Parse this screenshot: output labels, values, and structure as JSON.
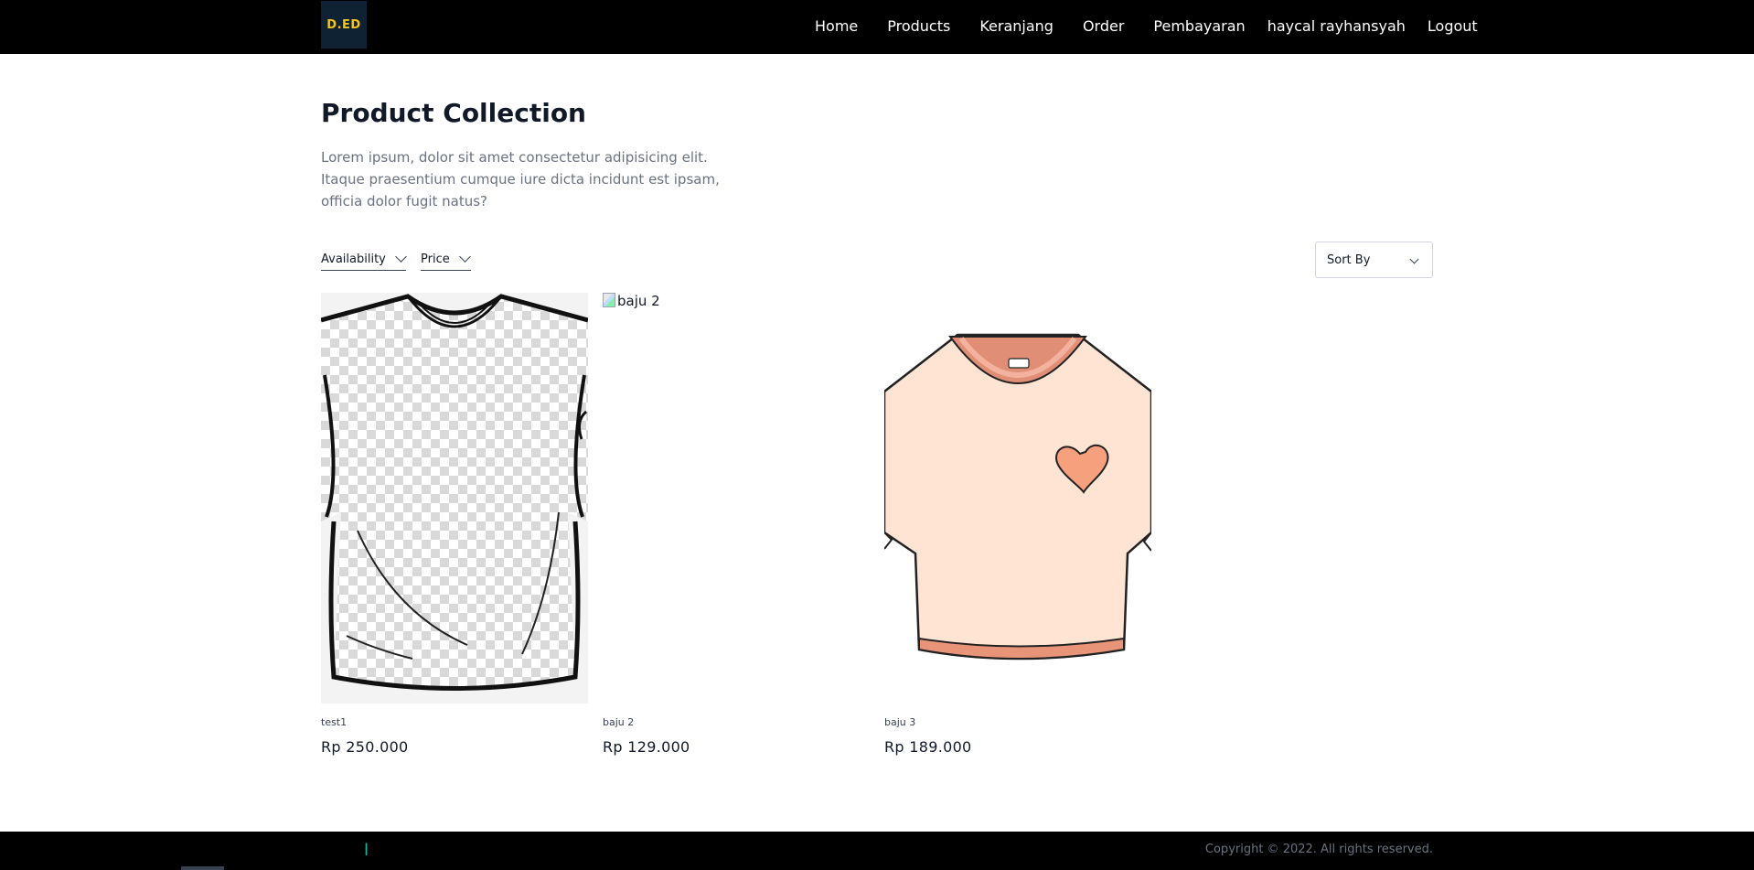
{
  "header": {
    "logo_text": "D.ED",
    "nav": [
      "Home",
      "Products",
      "Keranjang",
      "Order",
      "Pembayaran",
      "haycal rayhansyah",
      "Logout"
    ]
  },
  "main": {
    "title": "Product Collection",
    "description": "Lorem ipsum, dolor sit amet consectetur adipisicing elit. Itaque praesentium cumque iure dicta incidunt est ipsam, officia dolor fugit natus?",
    "filters": {
      "availability": "Availability",
      "price": "Price"
    },
    "sort_label": "Sort By",
    "products": [
      {
        "name": "test1",
        "price": "Rp 250.000"
      },
      {
        "name": "baju 2",
        "price": "Rp 129.000",
        "alt": "baju 2"
      },
      {
        "name": "baju 3",
        "price": "Rp 189.000"
      }
    ]
  },
  "footer": {
    "mark": "l",
    "copyright": "Copyright © 2022. All rights reserved."
  },
  "colors": {
    "header_bg": "#000000",
    "logo_bg": "#0f2233",
    "logo_text": "#f5c518",
    "shirt_peach": "#ffe4d4",
    "heart": "#f7a07e"
  }
}
